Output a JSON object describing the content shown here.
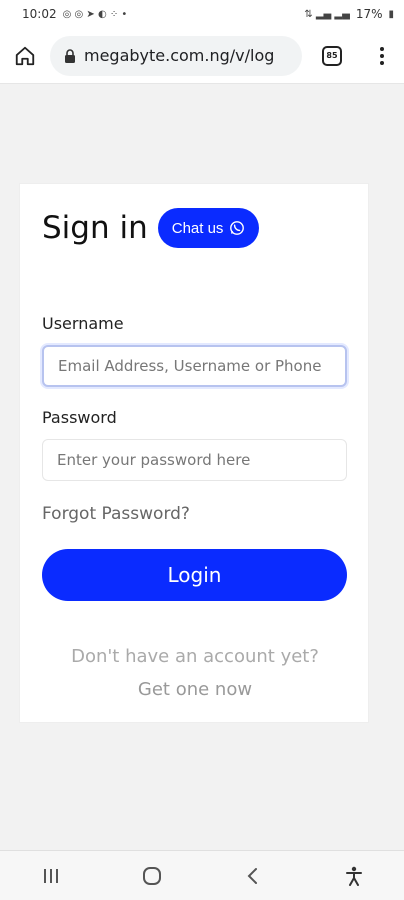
{
  "status_bar": {
    "time": "10:02",
    "battery": "17%"
  },
  "browser": {
    "url": "megabyte.com.ng/v/log",
    "tab_count": "85"
  },
  "login": {
    "title": "Sign in",
    "chat_label": "Chat us",
    "username_label": "Username",
    "username_placeholder": "Email Address, Username or Phone",
    "password_label": "Password",
    "password_placeholder": "Enter your password here",
    "forgot_password": "Forgot Password?",
    "login_button": "Login",
    "no_account_text": "Don't have an account yet?",
    "get_one_link": "Get one now"
  },
  "icons": {
    "home": "home-icon",
    "lock": "lock-icon",
    "tabs": "tabs-icon",
    "menu": "more-vert-icon",
    "whatsapp": "whatsapp-icon",
    "recents": "recents-icon",
    "home_nav": "home-nav-icon",
    "back": "back-icon",
    "accessibility": "accessibility-icon"
  },
  "colors": {
    "accent": "#0a2bff",
    "page_bg": "#f2f2f2"
  }
}
